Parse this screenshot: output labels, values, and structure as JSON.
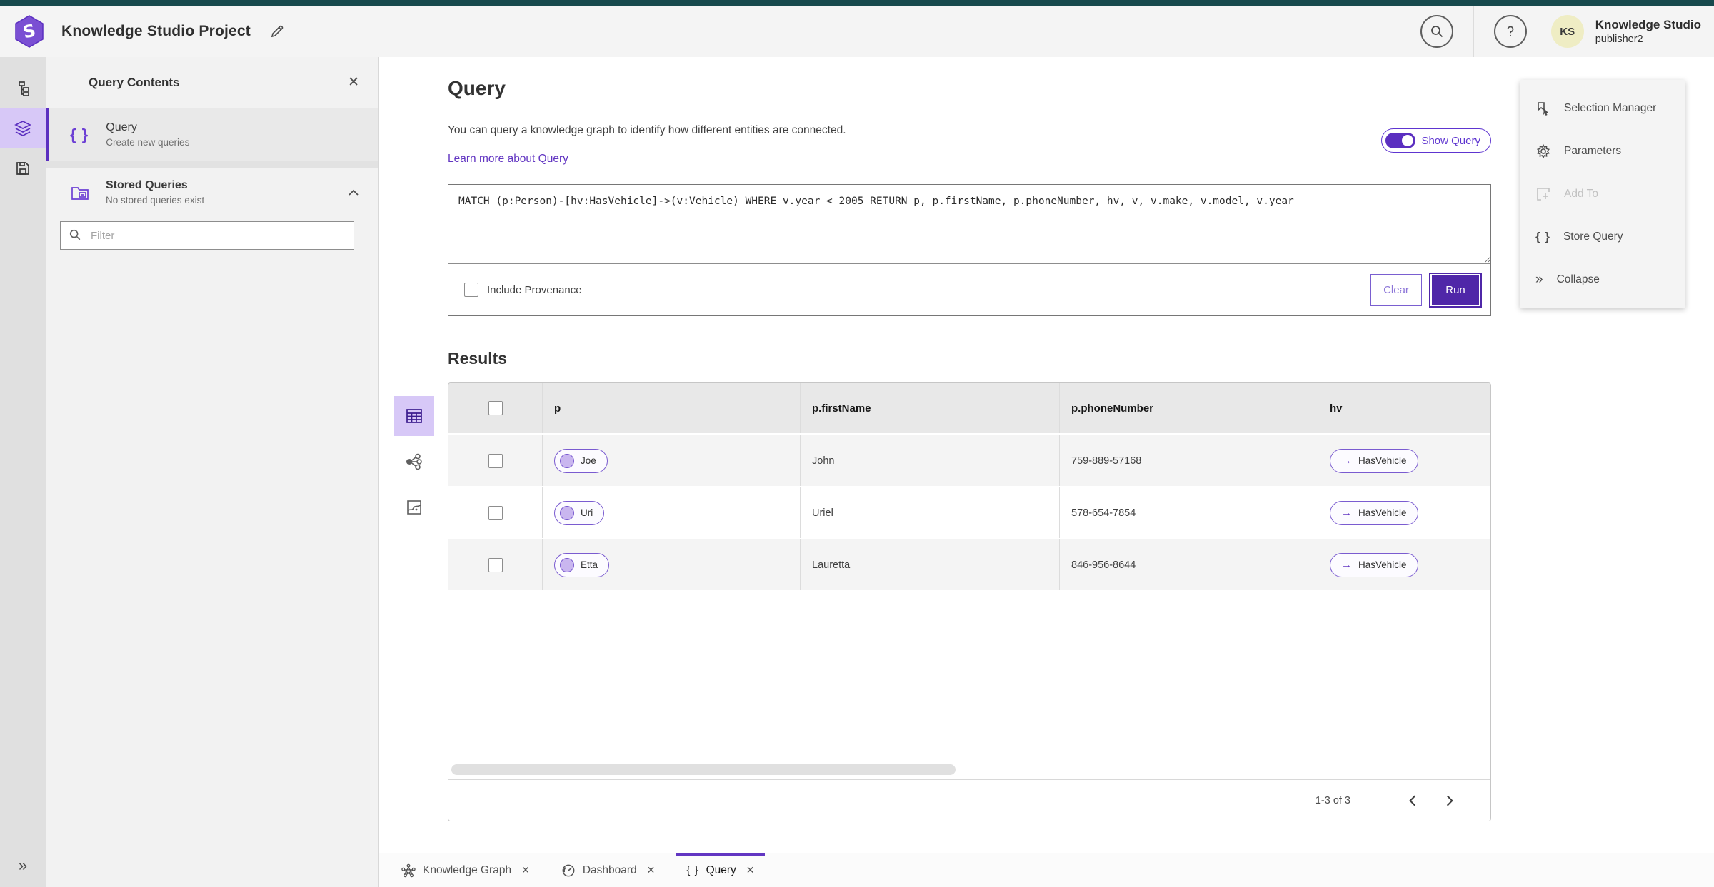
{
  "header": {
    "app_title": "Knowledge Studio Project",
    "user_initials": "KS",
    "user_org": "Knowledge Studio",
    "user_name": "publisher2"
  },
  "left_panel": {
    "title": "Query Contents",
    "query_item": {
      "label": "Query",
      "sublabel": "Create new queries"
    },
    "stored_item": {
      "label": "Stored Queries",
      "sublabel": "No stored queries exist"
    },
    "filter_placeholder": "Filter"
  },
  "main": {
    "title": "Query",
    "description": "You can query a knowledge graph to identify how different entities are connected.",
    "learn_link": "Learn more about Query",
    "toggle_label": "Show Query",
    "query_text": "MATCH (p:Person)-[hv:HasVehicle]->(v:Vehicle) WHERE v.year < 2005 RETURN p, p.firstName, p.phoneNumber, hv, v, v.make, v.model, v.year",
    "provenance_label": "Include Provenance",
    "clear_label": "Clear",
    "run_label": "Run",
    "results_title": "Results"
  },
  "table": {
    "columns": [
      "p",
      "p.firstName",
      "p.phoneNumber",
      "hv"
    ],
    "rows": [
      {
        "p": "Joe",
        "firstName": "John",
        "phoneNumber": "759-889-57168",
        "hv": "HasVehicle"
      },
      {
        "p": "Uri",
        "firstName": "Uriel",
        "phoneNumber": "578-654-7854",
        "hv": "HasVehicle"
      },
      {
        "p": "Etta",
        "firstName": "Lauretta",
        "phoneNumber": "846-956-8644",
        "hv": "HasVehicle"
      }
    ],
    "pagination": "1-3 of 3"
  },
  "tool_panel": {
    "selection_manager": "Selection Manager",
    "parameters": "Parameters",
    "add_to": "Add To",
    "store_query": "Store Query",
    "collapse": "Collapse"
  },
  "tabs": {
    "knowledge_graph": "Knowledge Graph",
    "dashboard": "Dashboard",
    "query": "Query"
  },
  "icons": {
    "braces": "{ }",
    "close": "✕",
    "arrow_right": "→",
    "double_chevron": "»"
  },
  "colors": {
    "accent_purple": "#6236c2",
    "run_purple": "#4f27a8",
    "teal_strip": "#17494d",
    "active_icon_bg": "#d7c8f7",
    "node_fill": "#c9b6ef",
    "avatar_bg": "#efedc4"
  }
}
